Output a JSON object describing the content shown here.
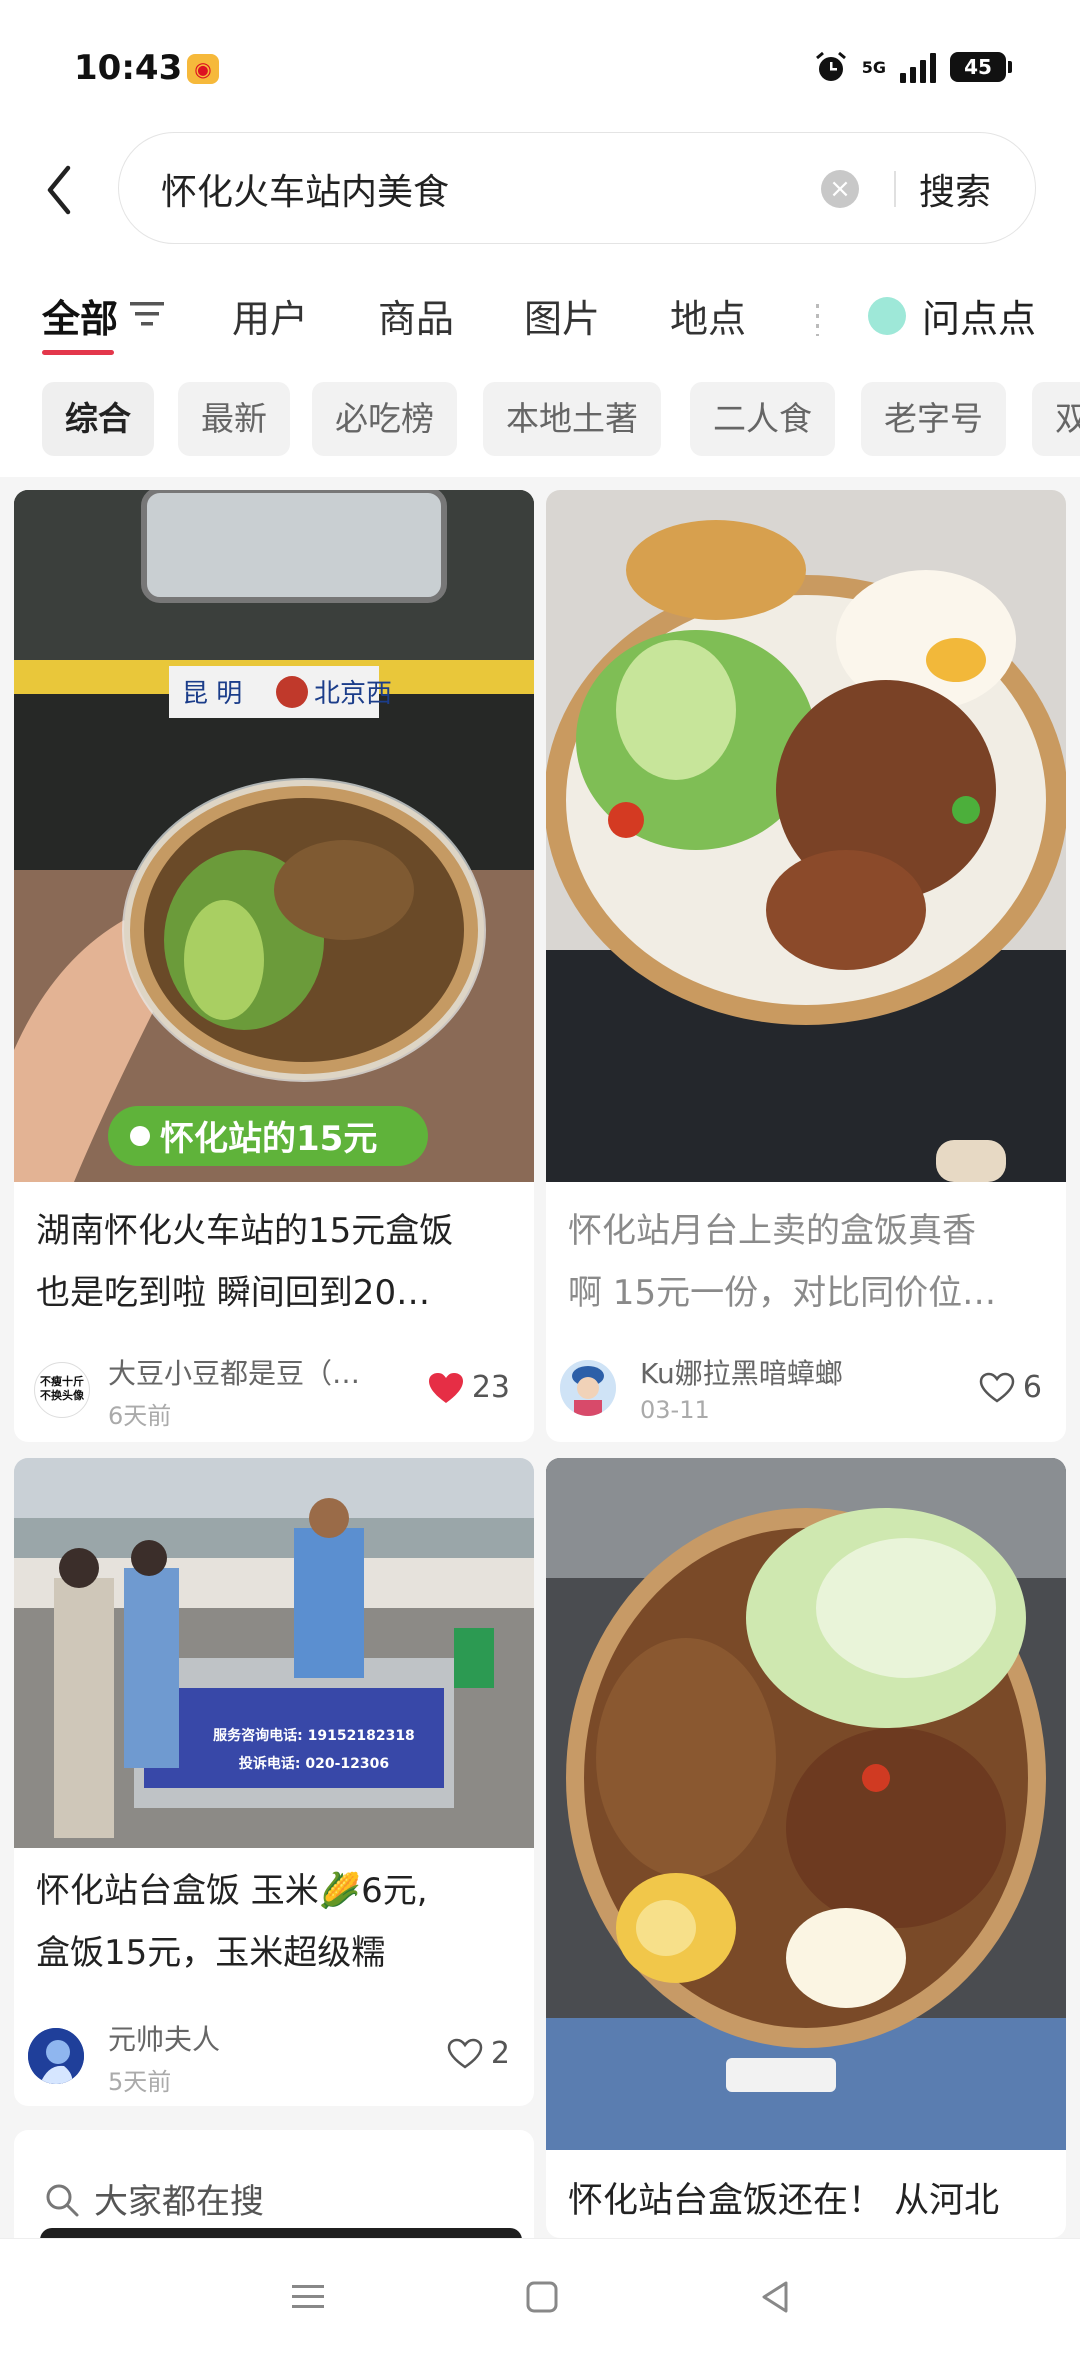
{
  "status_bar": {
    "time": "10:43",
    "network": "5G",
    "battery": "45"
  },
  "search": {
    "query": "怀化火车站内美食",
    "button": "搜索"
  },
  "tabs": [
    {
      "label": "全部",
      "active": true
    },
    {
      "label": "用户"
    },
    {
      "label": "商品"
    },
    {
      "label": "图片"
    },
    {
      "label": "地点"
    }
  ],
  "ask_label": "问点点",
  "chips": [
    {
      "label": "综合",
      "active": true
    },
    {
      "label": "最新"
    },
    {
      "label": "必吃榜"
    },
    {
      "label": "本地土著"
    },
    {
      "label": "二人食"
    },
    {
      "label": "老字号"
    },
    {
      "label": "双"
    }
  ],
  "cards": [
    {
      "title_line1": "湖南怀化火车站的15元盒饭",
      "title_line2": "也是吃到啦 瞬间回到20…",
      "author": "大豆小豆都是豆（…",
      "date": "6天前",
      "likes": "23",
      "liked": true,
      "tag": "怀化站的15元",
      "train_sign_left": "昆 明",
      "train_sign_right": "北京西",
      "avatar_text_line1": "不瘦十斤",
      "avatar_text_line2": "不换头像"
    },
    {
      "title_line1": "怀化站月台上卖的盒饭真香",
      "title_line2": "啊 15元一份，对比同价位…",
      "author": "Ku娜拉黑暗蟑螂",
      "date": "03-11",
      "likes": "6",
      "liked": false
    },
    {
      "title_line1": "怀化站台盒饭 玉米🌽6元,",
      "title_line2": "盒饭15元，玉米超级糯",
      "author": "元帅夫人",
      "date": "5天前",
      "likes": "2",
      "liked": false,
      "cart_phone1": "服务咨询电话: 19152182318",
      "cart_phone2": "投诉电话: 020-12306"
    },
    {
      "title_line1": "怀化站台盒饭还在！ 从河北"
    }
  ],
  "suggest_label": "大家都在搜",
  "colors": {
    "accent": "#e3374b",
    "tag_green": "#5fb33a",
    "chip_bg": "#f2f2f2",
    "feed_bg": "#f5f5f5"
  }
}
